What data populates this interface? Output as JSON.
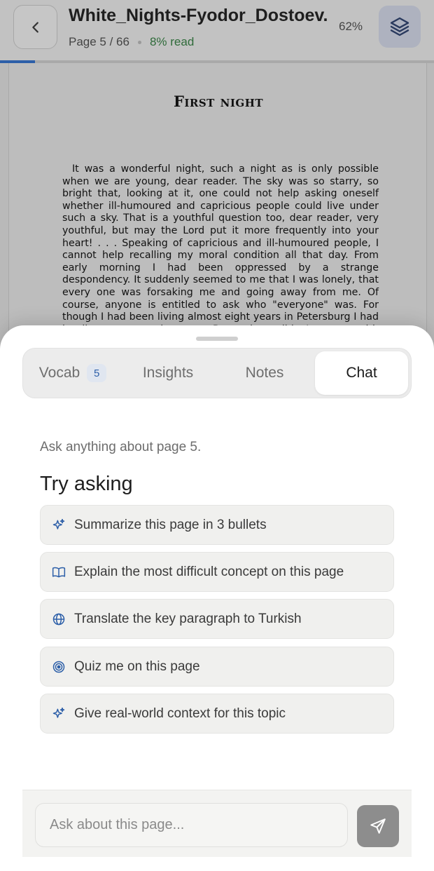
{
  "header": {
    "title": "White_Nights-Fyodor_Dostoev...",
    "page_indicator": "Page 5 / 66",
    "read_status": "8% read",
    "read_fraction": 0.08,
    "zoom_level": "62%",
    "back_icon": "chevron-left-icon",
    "layers_icon": "layers-icon"
  },
  "document": {
    "chapter_title": "First night",
    "body_text": "It was a wonderful night, such a night as is only possible when we are young, dear reader. The sky was so starry, so bright that, looking at it, one could not help asking oneself whether ill-humoured and capricious people could live under such a sky. That is a youthful question too, dear reader, very youthful, but may the Lord put it more frequently into your heart! . . . Speaking of capricious and ill-humoured people, I cannot help recalling my moral condition all that day. From early morning I had been oppressed by a strange despondency. It suddenly seemed to me that I was lonely, that every one was forsaking me and going away from me. Of course, anyone is entitled to ask who \"everyone\" was. For though I had been living almost eight years in Petersburg I had hardly an acquaintance. But what did I want with acquaintances? I was acquainted with all"
  },
  "tabs": [
    {
      "label": "Vocab",
      "badge": "5"
    },
    {
      "label": "Insights"
    },
    {
      "label": "Notes"
    },
    {
      "label": "Chat",
      "active": true
    }
  ],
  "chat": {
    "hint": "Ask anything about page 5.",
    "try_heading": "Try asking",
    "suggestions": [
      {
        "label": "Summarize this page in 3 bullets",
        "icon": "sparkles-icon"
      },
      {
        "label": "Explain the most difficult concept on this page",
        "icon": "book-open-icon"
      },
      {
        "label": "Translate the key paragraph to Turkish",
        "icon": "globe-icon"
      },
      {
        "label": "Quiz me on this page",
        "icon": "target-icon"
      },
      {
        "label": "Give real-world context for this topic",
        "icon": "sparkles-icon"
      }
    ],
    "input_placeholder": "Ask about this page...",
    "input_value": "",
    "send_icon": "send-icon"
  },
  "colors": {
    "accent": "#2d5fa8",
    "read_status": "#2f6b3a",
    "send_button": "#8d8d8d"
  }
}
